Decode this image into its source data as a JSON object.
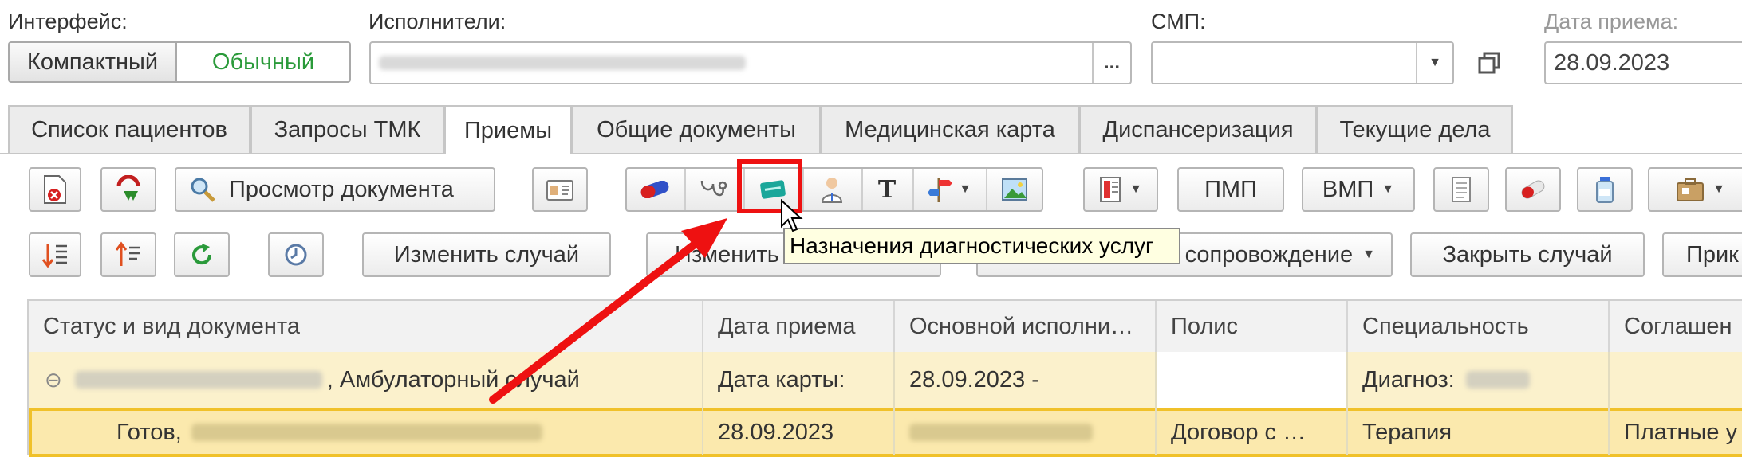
{
  "header": {
    "interface_label": "Интерфейс:",
    "interface_options": [
      "Компактный",
      "Обычный"
    ],
    "executors_label": "Исполнители:",
    "executors_more": "...",
    "smp_label": "СМП:",
    "date_label": "Дата приема:",
    "date_value": "28.09.2023"
  },
  "tabs": [
    "Список пациентов",
    "Запросы ТМК",
    "Приемы",
    "Общие документы",
    "Медицинская карта",
    "Диспансеризация",
    "Текущие дела"
  ],
  "toolbar": {
    "view_document": "Просмотр документа",
    "pmp": "ПМП",
    "vmp": "ВМП",
    "text_tool": "T",
    "change_case": "Изменить случай",
    "change_partial": "Изменить",
    "escort_partial": "сопровождение",
    "close_case": "Закрыть случай",
    "right_partial": "Прик"
  },
  "tooltip": "Назначения диагностических услуг",
  "table": {
    "columns": [
      "Статус и вид документа",
      "Дата приема",
      "Основной исполни…",
      "Полис",
      "Специальность",
      "Соглашен"
    ],
    "group_row": {
      "collapse": "⊖",
      "title_suffix": ", Амбулаторный случай",
      "date_label": "Дата карты:",
      "date_value": "28.09.2023 -",
      "diagnosis_label": "Диагноз:"
    },
    "rows": [
      {
        "status": "Готов,",
        "date": "28.09.2023",
        "policy": "Договор с …",
        "specialty": "Терапия",
        "agreement": "Платные у"
      }
    ]
  },
  "colors": {
    "accent_green": "#2a9a3a",
    "highlight_red": "#ee1111",
    "group_row_bg": "#fbf1cc",
    "selected_row_bg": "#fbe9ad",
    "selected_row_border": "#f0c12a",
    "tooltip_bg": "#ffffe1"
  }
}
